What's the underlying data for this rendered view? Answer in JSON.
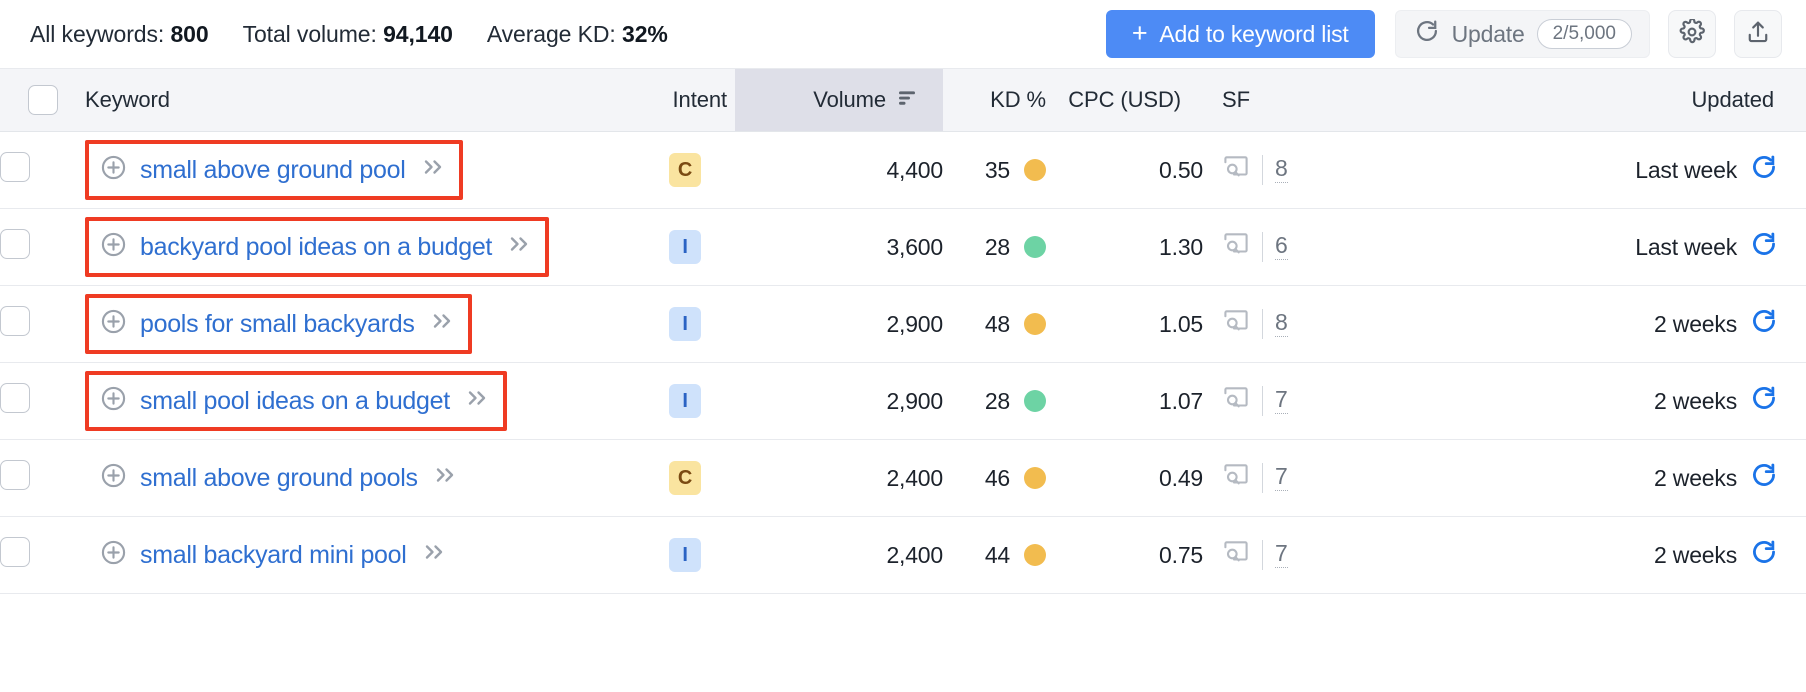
{
  "toolbar": {
    "summary": [
      {
        "label": "All keywords:",
        "value": "800"
      },
      {
        "label": "Total volume:",
        "value": "94,140"
      },
      {
        "label": "Average KD:",
        "value": "32%"
      }
    ],
    "add_button": {
      "label": "Add to keyword list",
      "icon": "plus-icon"
    },
    "update_button": {
      "label": "Update",
      "counter": "2/5,000",
      "icon": "refresh-icon"
    },
    "settings_button": {
      "icon": "gear-icon"
    },
    "export_button": {
      "icon": "export-upload-icon"
    }
  },
  "table": {
    "columns": [
      {
        "key": "checkbox",
        "label": ""
      },
      {
        "key": "keyword",
        "label": "Keyword"
      },
      {
        "key": "intent",
        "label": "Intent"
      },
      {
        "key": "volume",
        "label": "Volume",
        "sorted": true,
        "sort_icon": "sort-descending-icon"
      },
      {
        "key": "kd",
        "label": "KD %"
      },
      {
        "key": "cpc",
        "label": "CPC (USD)"
      },
      {
        "key": "sf",
        "label": "SF"
      },
      {
        "key": "updated",
        "label": "Updated"
      }
    ],
    "rows": [
      {
        "keyword": "small above ground pool",
        "highlighted": true,
        "intent": "C",
        "volume": "4,400",
        "kd": "35",
        "kd_color": "#f2bc4f",
        "cpc": "0.50",
        "sf": "8",
        "updated": "Last week"
      },
      {
        "keyword": "backyard pool ideas on a budget",
        "highlighted": true,
        "intent": "I",
        "volume": "3,600",
        "kd": "28",
        "kd_color": "#6dd3a4",
        "cpc": "1.30",
        "sf": "6",
        "updated": "Last week"
      },
      {
        "keyword": "pools for small backyards",
        "highlighted": true,
        "intent": "I",
        "volume": "2,900",
        "kd": "48",
        "kd_color": "#f2bc4f",
        "cpc": "1.05",
        "sf": "8",
        "updated": "2 weeks"
      },
      {
        "keyword": "small pool ideas on a budget",
        "highlighted": true,
        "intent": "I",
        "volume": "2,900",
        "kd": "28",
        "kd_color": "#6dd3a4",
        "cpc": "1.07",
        "sf": "7",
        "updated": "2 weeks"
      },
      {
        "keyword": "small above ground pools",
        "highlighted": false,
        "intent": "C",
        "volume": "2,400",
        "kd": "46",
        "kd_color": "#f2bc4f",
        "cpc": "0.49",
        "sf": "7",
        "updated": "2 weeks"
      },
      {
        "keyword": "small backyard mini pool",
        "highlighted": false,
        "intent": "I",
        "volume": "2,400",
        "kd": "44",
        "kd_color": "#f2bc4f",
        "cpc": "0.75",
        "sf": "7",
        "updated": "2 weeks"
      }
    ],
    "row_icons": {
      "add_keyword": "plus-circle-icon",
      "expand": "chevron-double-right-icon",
      "serp": "serp-preview-icon",
      "refresh": "refresh-icon"
    }
  },
  "colors": {
    "accent_blue": "#4d8bf5",
    "link_blue": "#2f6fd0",
    "annotation_red": "#ef3b23",
    "kd_easy_green": "#6dd3a4",
    "kd_medium_amber": "#f2bc4f"
  }
}
